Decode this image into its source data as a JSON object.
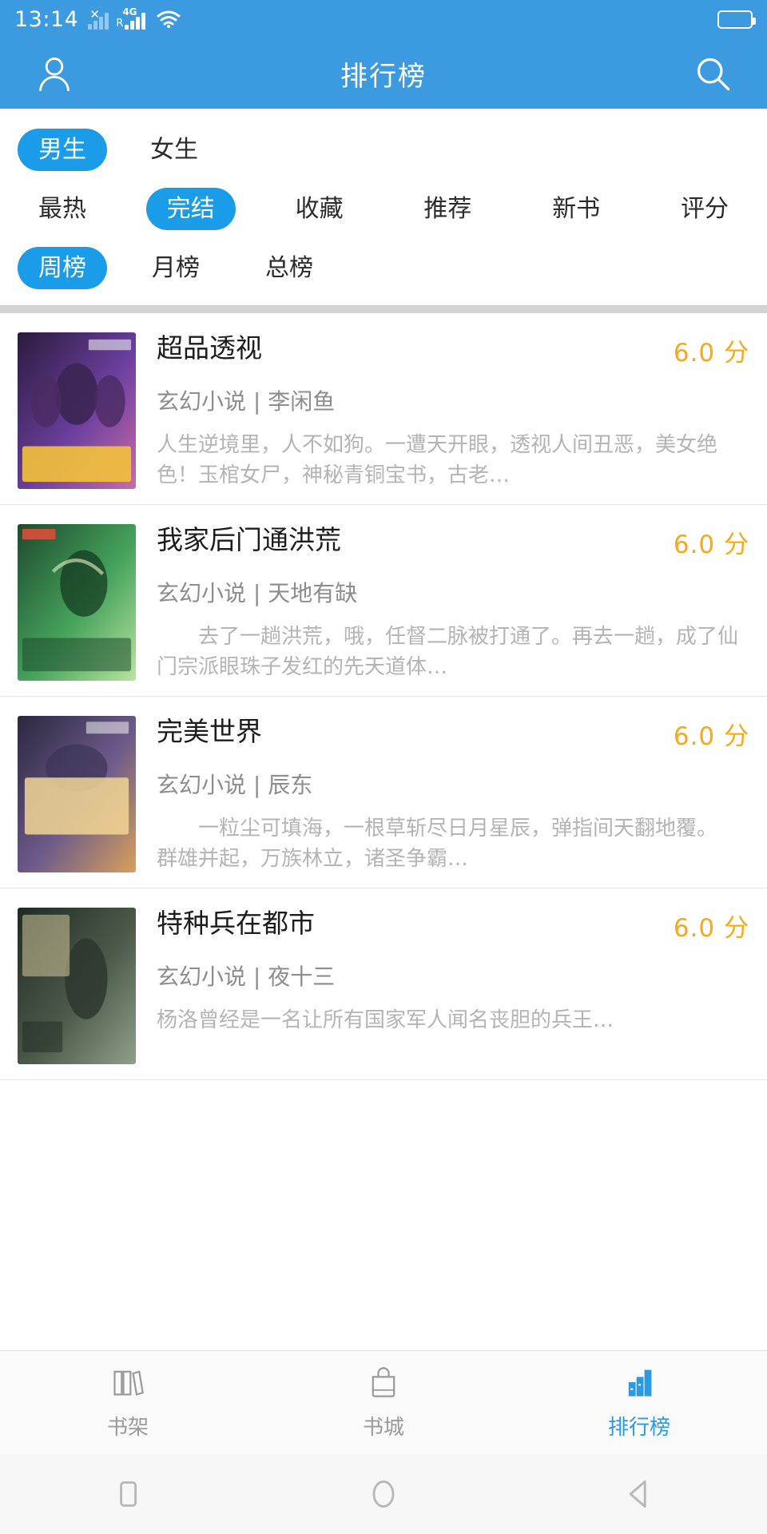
{
  "status_bar": {
    "time": "13:14",
    "network_label": "4G",
    "roaming_label": "R",
    "icons": [
      "x-icon",
      "signal-icon",
      "4g-signal-icon",
      "wifi-icon",
      "battery-icon"
    ]
  },
  "app_bar": {
    "title": "排行榜",
    "profile_icon": "person-icon",
    "search_icon": "search-icon"
  },
  "filters": {
    "gender_row": [
      {
        "label": "男生",
        "active": true
      },
      {
        "label": "女生",
        "active": false
      }
    ],
    "category_row": [
      {
        "label": "最热",
        "active": false
      },
      {
        "label": "完结",
        "active": true
      },
      {
        "label": "收藏",
        "active": false
      },
      {
        "label": "推荐",
        "active": false
      },
      {
        "label": "新书",
        "active": false
      },
      {
        "label": "评分",
        "active": false
      }
    ],
    "period_row": [
      {
        "label": "周榜",
        "active": true
      },
      {
        "label": "月榜",
        "active": false
      },
      {
        "label": "总榜",
        "active": false
      }
    ]
  },
  "books": [
    {
      "title": "超品透视",
      "category": "玄幻小说",
      "author": "李闲鱼",
      "meta": "玄幻小说 | 李闲鱼",
      "score": "6.0 分",
      "description": "人生逆境里，人不如狗。一遭天开眼，透视人间丑恶，美女绝色！玉棺女尸，神秘青铜宝书，古老…",
      "cover_colors": [
        "#2a1b3d",
        "#6b3f9e",
        "#c86ba8",
        "#f4c13a"
      ]
    },
    {
      "title": "我家后门通洪荒",
      "category": "玄幻小说",
      "author": "天地有缺",
      "meta": "玄幻小说 | 天地有缺",
      "score": "6.0 分",
      "description": "　　去了一趟洪荒，哦，任督二脉被打通了。再去一趟，成了仙门宗派眼珠子发红的先天道体…",
      "cover_colors": [
        "#1d4a2e",
        "#46a35c",
        "#b9e4a0",
        "#e8f2c8"
      ]
    },
    {
      "title": "完美世界",
      "category": "玄幻小说",
      "author": "辰东",
      "meta": "玄幻小说 | 辰东",
      "score": "6.0 分",
      "description": "　　一粒尘可填海，一根草斩尽日月星辰，弹指间天翻地覆。　　群雄并起，万族林立，诸圣争霸…",
      "cover_colors": [
        "#2b2740",
        "#6e5b8a",
        "#d9a05b",
        "#f2d694"
      ]
    },
    {
      "title": "特种兵在都市",
      "category": "玄幻小说",
      "author": "夜十三",
      "meta": "玄幻小说 | 夜十三",
      "score": "6.0 分",
      "description": "杨洛曾经是一名让所有国家军人闻名丧胆的兵王…",
      "cover_colors": [
        "#1f2a24",
        "#4d5a4a",
        "#8fa08a",
        "#d4c79a"
      ]
    }
  ],
  "bottom_nav": [
    {
      "label": "书架",
      "icon": "bookshelf-icon",
      "active": false
    },
    {
      "label": "书城",
      "icon": "shopping-bag-icon",
      "active": false
    },
    {
      "label": "排行榜",
      "icon": "bar-chart-icon",
      "active": true
    }
  ],
  "android_nav": [
    {
      "icon": "recents-square-icon"
    },
    {
      "icon": "home-circle-icon"
    },
    {
      "icon": "back-triangle-icon"
    }
  ],
  "colors": {
    "brand_blue": "#3c9ae0",
    "chip_blue": "#1a9ce8",
    "score_orange": "#f7a81b",
    "separator_gray": "#d2d2d2",
    "nav_active": "#2a9ae5"
  }
}
